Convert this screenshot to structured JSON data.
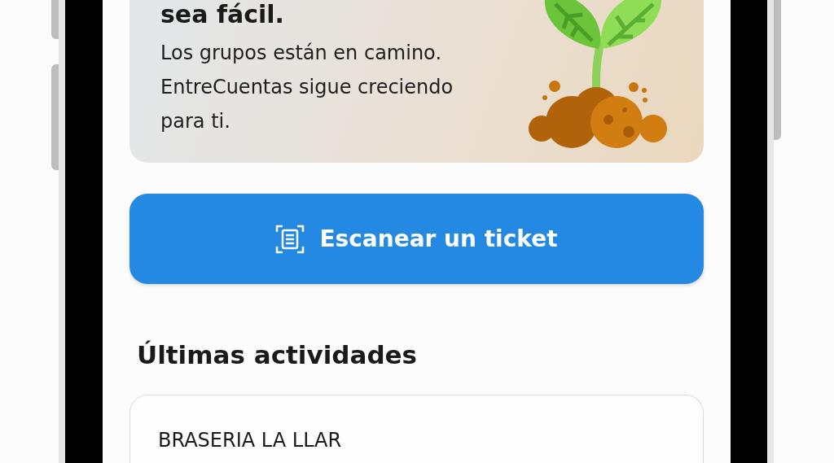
{
  "banner": {
    "title": "sea fácil.",
    "text": "Los grupos están en camino. EntreCuentas sigue creciendo para ti."
  },
  "scan_button": {
    "label": "Escanear un ticket"
  },
  "recent": {
    "title": "Últimas actividades",
    "items": [
      {
        "name": "BRASERIA LA LLAR"
      }
    ]
  }
}
